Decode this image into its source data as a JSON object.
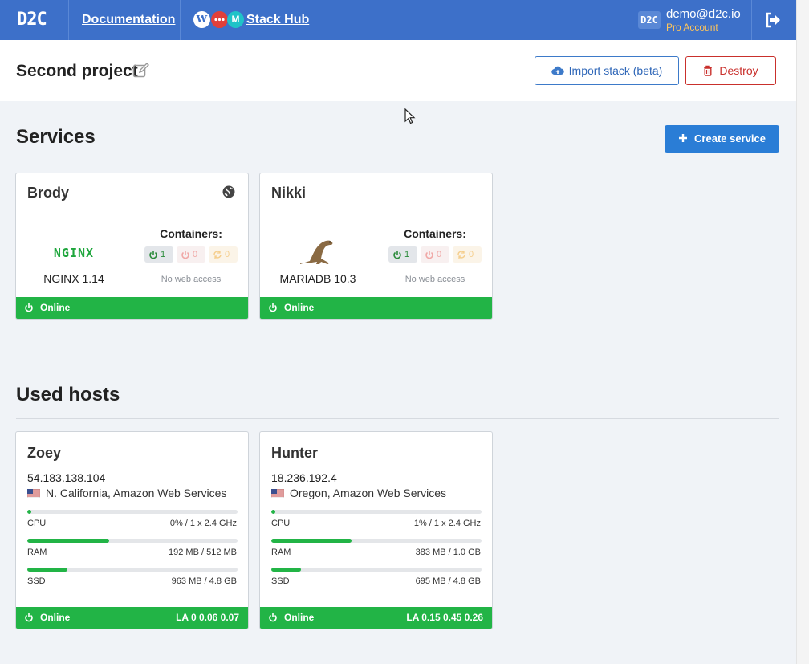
{
  "nav": {
    "logo": "D2C",
    "documentation": "Documentation",
    "stack_hub": "Stack Hub",
    "hub_icon_m": "M",
    "user_avatar": "D2C",
    "user_email": "demo@d2c.io",
    "account_type": "Pro Account"
  },
  "project": {
    "title": "Second project",
    "import_label": "Import stack (beta)",
    "destroy_label": "Destroy"
  },
  "services_section": {
    "title": "Services",
    "create_label": "Create service"
  },
  "services": [
    {
      "name": "Brody",
      "logo_text": "NGINX",
      "version": "NGINX 1.14",
      "containers_label": "Containers:",
      "running": "1",
      "stopped": "0",
      "restarting": "0",
      "web_access": "No web access",
      "status": "Online",
      "has_globe": true
    },
    {
      "name": "Nikki",
      "logo_text": "",
      "version": "MARIADB 10.3",
      "containers_label": "Containers:",
      "running": "1",
      "stopped": "0",
      "restarting": "0",
      "web_access": "No web access",
      "status": "Online",
      "has_globe": false
    }
  ],
  "hosts_section": {
    "title": "Used hosts"
  },
  "hosts": [
    {
      "name": "Zoey",
      "ip": "54.183.138.104",
      "location": "N. California, Amazon Web Services",
      "cpu_label": "CPU",
      "cpu_value": "0% / 1 x 2.4 GHz",
      "cpu_fraction": 0.02,
      "ram_label": "RAM",
      "ram_value": "192 MB / 512 MB",
      "ram_fraction": 0.39,
      "ssd_label": "SSD",
      "ssd_value": "963 MB / 4.8 GB",
      "ssd_fraction": 0.19,
      "status": "Online",
      "load_average": "LA 0 0.06 0.07"
    },
    {
      "name": "Hunter",
      "ip": "18.236.192.4",
      "location": "Oregon, Amazon Web Services",
      "cpu_label": "CPU",
      "cpu_value": "1% / 1 x 2.4 GHz",
      "cpu_fraction": 0.02,
      "ram_label": "RAM",
      "ram_value": "383 MB / 1.0 GB",
      "ram_fraction": 0.38,
      "ssd_label": "SSD",
      "ssd_value": "695 MB / 4.8 GB",
      "ssd_fraction": 0.14,
      "status": "Online",
      "load_average": "LA 0.15 0.45 0.26"
    }
  ],
  "colors": {
    "nav_blue": "#3d70c9",
    "online_green": "#22b446",
    "primary_blue": "#2a7dd6",
    "danger_red": "#c9302c"
  },
  "icons": [
    "d2c-logo-icon",
    "wordpress-icon",
    "chat-bubble-icon",
    "m-logo-icon",
    "logout-icon",
    "edit-icon",
    "cloud-upload-icon",
    "trash-icon",
    "plus-icon",
    "globe-icon",
    "power-icon",
    "restart-icon",
    "us-flag-icon",
    "seal-icon",
    "cursor-icon"
  ]
}
